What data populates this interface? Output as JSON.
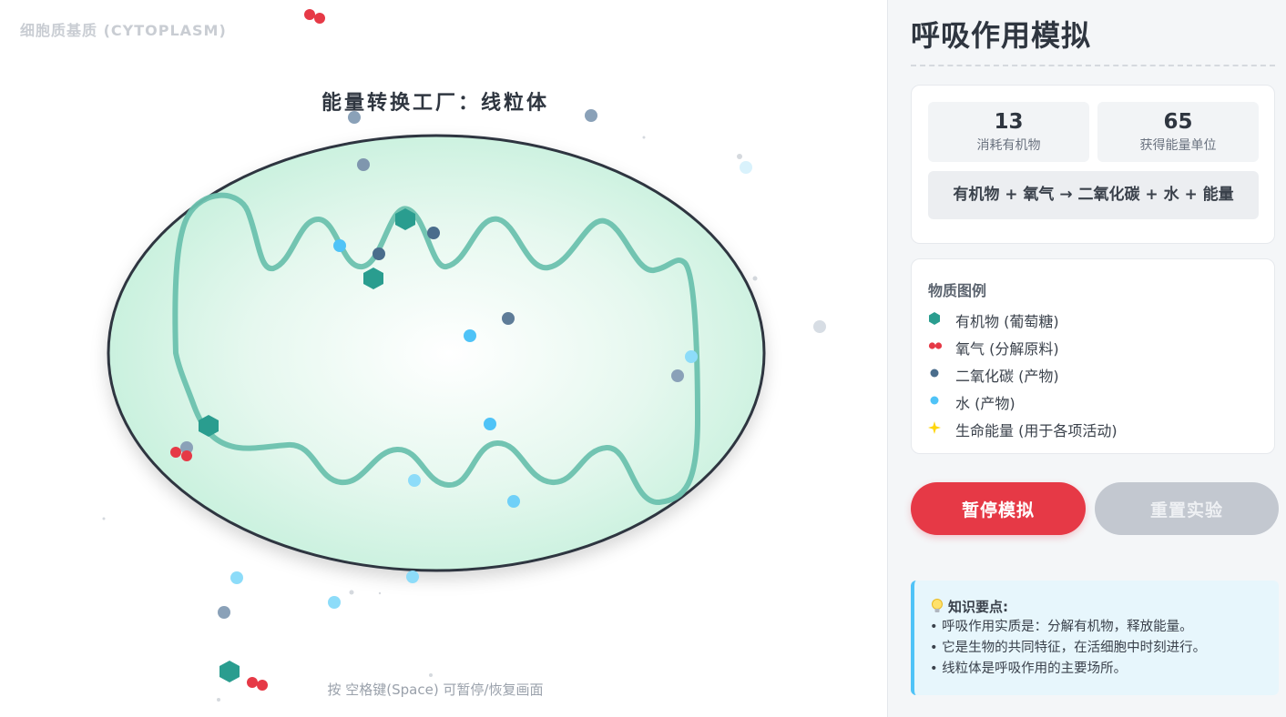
{
  "stage": {
    "cytoplasm_label": "细胞质基质 (CYTOPLASM)",
    "title": "能量转换工厂：线粒体",
    "hint": "按 空格键(Space) 可暂停/恢复画面"
  },
  "sidebar": {
    "title": "呼吸作用模拟",
    "stats": {
      "consumed_value": "13",
      "consumed_label": "消耗有机物",
      "energy_value": "65",
      "energy_label": "获得能量单位"
    },
    "equation": "有机物 + 氧气 → 二氧化碳 + 水 + 能量",
    "legend": {
      "title": "物质图例",
      "items": [
        {
          "icon": "hexagon-icon",
          "label": "有机物 (葡萄糖)"
        },
        {
          "icon": "oxygen-molecule-icon",
          "label": "氧气 (分解原料)"
        },
        {
          "icon": "co2-dot-icon",
          "label": "二氧化碳 (产物)"
        },
        {
          "icon": "water-dot-icon",
          "label": "水 (产物)"
        },
        {
          "icon": "energy-star-icon",
          "label": "生命能量 (用于各项活动)"
        }
      ]
    },
    "buttons": {
      "pause": "暂停模拟",
      "reset": "重置实验"
    },
    "knowledge": {
      "title": "知识要点:",
      "lines": [
        "• 呼吸作用实质是：分解有机物，释放能量。",
        "• 它是生物的共同特征，在活细胞中时刻进行。",
        "• 线粒体是呼吸作用的主要场所。"
      ]
    }
  },
  "colors": {
    "glucose": "#2a9d8f",
    "oxygen": "#e63946",
    "co2": "#4a6d8c",
    "water": "#4fc3f7",
    "energy": "#ffd60a",
    "pause_button": "#e63946",
    "reset_button": "#c3c8d0",
    "membrane_fill": "#c9f2df",
    "cristae": "#6cc1ae"
  }
}
